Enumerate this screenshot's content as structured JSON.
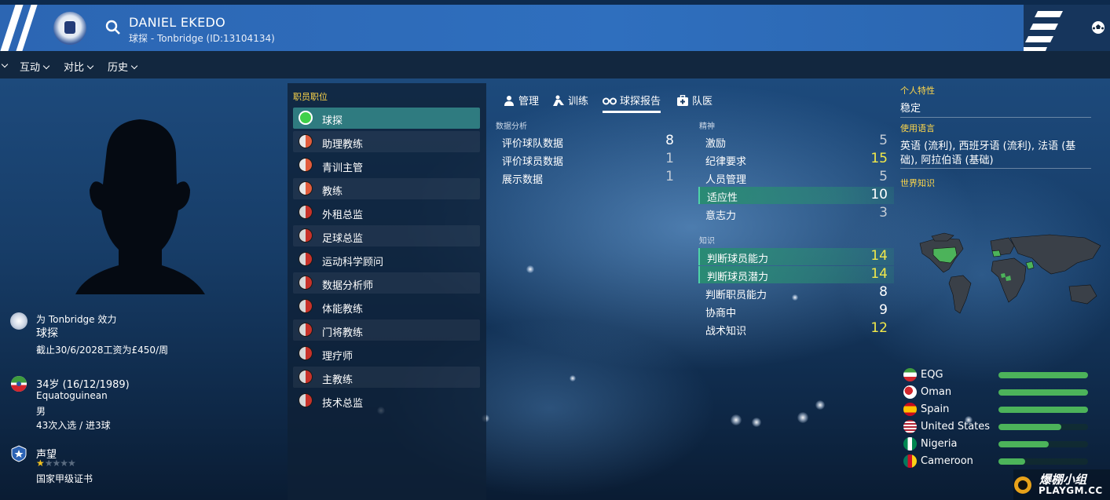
{
  "header": {
    "player_name": "DANIEL EKEDO",
    "subtitle": "球探 - Tonbridge (ID:13104134)"
  },
  "menu": {
    "items": [
      "互动",
      "对比",
      "历史"
    ]
  },
  "profile": {
    "club_line": "为 Tonbridge 效力",
    "role": "球探",
    "contract": "截止30/6/2028工资为£450/周",
    "age": "34岁 (16/12/1989)",
    "nationality": "Equatoguinean",
    "gender": "男",
    "caps": "43次入选 / 进3球",
    "reputation_label": "声望",
    "reputation_stars": 1,
    "license": "国家甲级证书"
  },
  "roles": {
    "title": "职员职位",
    "items": [
      {
        "label": "球探",
        "state": "full"
      },
      {
        "label": "助理教练",
        "state": "half"
      },
      {
        "label": "青训主管",
        "state": "half"
      },
      {
        "label": "教练",
        "state": "half"
      },
      {
        "label": "外租总监",
        "state": "low"
      },
      {
        "label": "足球总监",
        "state": "low"
      },
      {
        "label": "运动科学顾问",
        "state": "low"
      },
      {
        "label": "数据分析师",
        "state": "low"
      },
      {
        "label": "体能教练",
        "state": "low"
      },
      {
        "label": "门将教练",
        "state": "low"
      },
      {
        "label": "理疗师",
        "state": "low"
      },
      {
        "label": "主教练",
        "state": "low"
      },
      {
        "label": "技术总监",
        "state": "low"
      }
    ]
  },
  "tabs": [
    "管理",
    "训练",
    "球探报告",
    "队医"
  ],
  "analysis": {
    "title": "数据分析",
    "rows": [
      {
        "name": "评价球队数据",
        "value": "8"
      },
      {
        "name": "评价球员数据",
        "value": "1"
      },
      {
        "name": "展示数据",
        "value": "1"
      }
    ]
  },
  "mental": {
    "title": "精神",
    "rows": [
      {
        "name": "激励",
        "value": "5"
      },
      {
        "name": "纪律要求",
        "value": "15"
      },
      {
        "name": "人员管理",
        "value": "5"
      },
      {
        "name": "适应性",
        "value": "10"
      },
      {
        "name": "意志力",
        "value": "3"
      }
    ]
  },
  "knowledge": {
    "title": "知识",
    "rows": [
      {
        "name": "判断球员能力",
        "value": "14"
      },
      {
        "name": "判断球员潜力",
        "value": "14"
      },
      {
        "name": "判断职员能力",
        "value": "8"
      },
      {
        "name": "协商中",
        "value": "9"
      },
      {
        "name": "战术知识",
        "value": "12"
      }
    ]
  },
  "personal": {
    "traits_title": "个人特性",
    "traits_value": "稳定",
    "languages_title": "使用语言",
    "languages_line1": "英语 (流利), 西班牙语 (流利), 法语 (基",
    "languages_line2": "础), 阿拉伯语 (基础)",
    "world_title": "世界知识"
  },
  "world_knowledge": [
    {
      "country": "EQG",
      "level": 1.0
    },
    {
      "country": "Oman",
      "level": 1.0
    },
    {
      "country": "Spain",
      "level": 1.0
    },
    {
      "country": "United States",
      "level": 0.7
    },
    {
      "country": "Nigeria",
      "level": 0.56
    },
    {
      "country": "Cameroon",
      "level": 0.3
    }
  ],
  "watermark": {
    "text": "爆棚小组",
    "sub": "PLAYGM.CC"
  },
  "colors": {
    "header_blue": "#2f6fbe",
    "highlight_green": "#2a8a74",
    "accent_yellow": "#ffd74a"
  }
}
